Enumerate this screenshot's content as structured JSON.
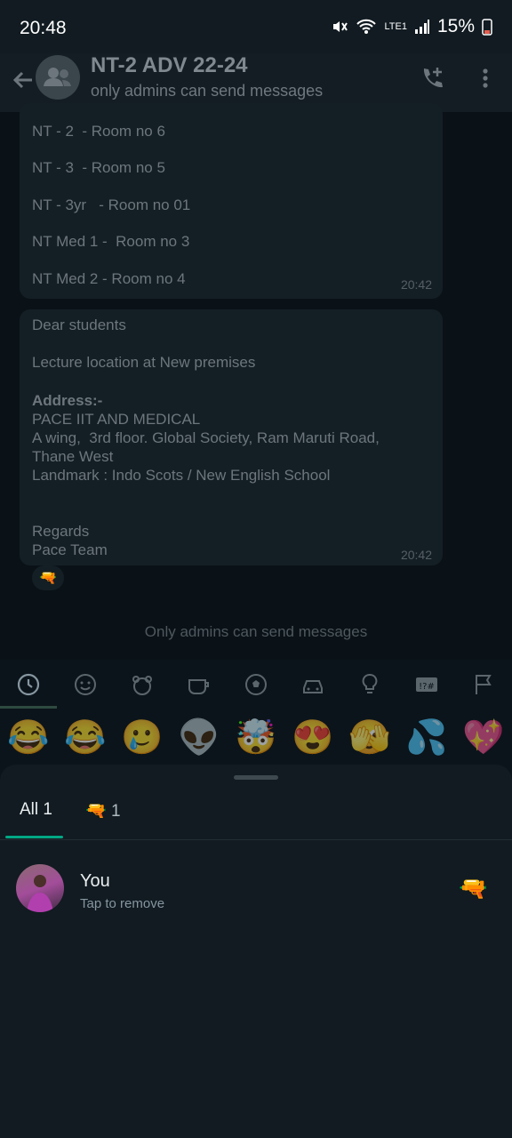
{
  "status_bar": {
    "time": "20:48",
    "network": "LTE1",
    "battery": "15%"
  },
  "header": {
    "title": "NT-2 ADV 22-24",
    "subtitle": "only admins can send messages"
  },
  "messages": [
    {
      "lines": [
        "NT - 2  - Room no 6",
        "NT - 3  - Room no 5",
        "NT - 3yr   - Room no 01",
        "NT Med 1 -  Room no 3",
        "NT Med 2 - Room no 4"
      ],
      "time": "20:42"
    },
    {
      "lines": [
        "Dear students",
        "Lecture location at New premises",
        "Address:-",
        "PACE IIT AND MEDICAL",
        "A wing,  3rd floor. Global Society, Ram Maruti Road,",
        "Thane West",
        "Landmark : Indo Scots / New English School",
        "Regards",
        "Pace Team"
      ],
      "time": "20:42"
    }
  ],
  "reaction_chip": "🔫",
  "footer_note": "Only admins can send messages",
  "emoji_categories": [
    "recent-icon",
    "smiley-icon",
    "animal-icon",
    "food-icon",
    "activity-icon",
    "travel-icon",
    "objects-icon",
    "symbols-icon",
    "flags-icon"
  ],
  "emoji_row": [
    "😂",
    "😂",
    "🥲",
    "👽",
    "🤯",
    "😍",
    "🫣",
    "💦",
    "💖"
  ],
  "sheet": {
    "tab_all": "All 1",
    "tab_emoji": "🔫",
    "tab_emoji_count": "1",
    "user_name": "You",
    "user_sub": "Tap to remove",
    "user_reaction": "🔫"
  },
  "colors": {
    "accent": "#00a884",
    "background": "#0b141a",
    "sheet": "#111b21"
  }
}
